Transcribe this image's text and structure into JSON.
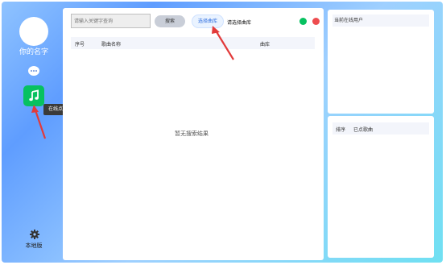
{
  "sidebar": {
    "username": "你的名字",
    "music_tooltip": "在线点歌",
    "local_label": "本地版"
  },
  "toolbar": {
    "search_placeholder": "请输入关键字查询",
    "search_label": "搜索",
    "select_library_label": "选择曲库",
    "status_text": "请选择曲库"
  },
  "song_table": {
    "columns": [
      "序号",
      "歌曲名称",
      "曲库"
    ],
    "empty_message": "暂无搜索结果"
  },
  "online_users": {
    "title": "当前在线用户"
  },
  "queue": {
    "columns": [
      "排序",
      "已点歌曲"
    ]
  },
  "colors": {
    "accent_green": "#07c160",
    "close_red": "#ee4c4f",
    "annotation_arrow": "#e23a3a"
  }
}
